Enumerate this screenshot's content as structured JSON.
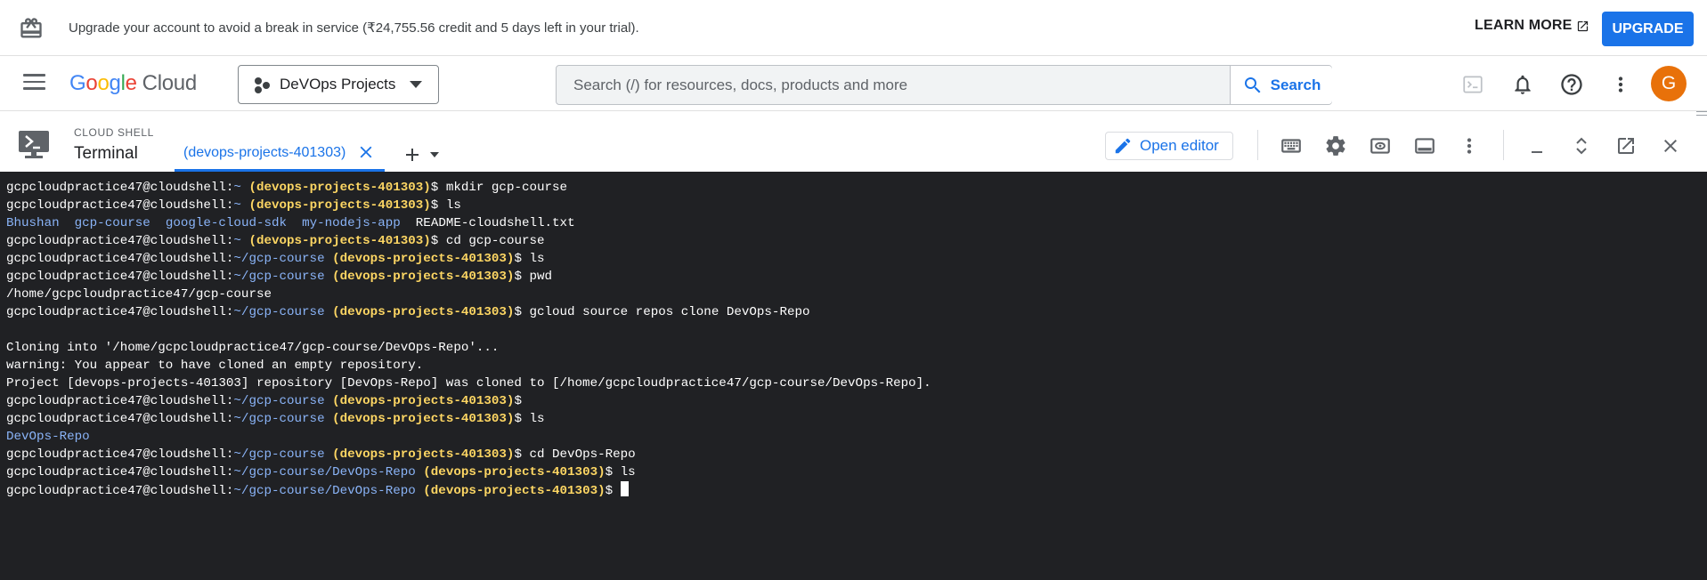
{
  "banner": {
    "message": "Upgrade your account to avoid a break in service (₹24,755.56 credit and 5 days left in your trial).",
    "learn_more": "LEARN MORE",
    "upgrade": "UPGRADE"
  },
  "topnav": {
    "logo_google": [
      "G",
      "o",
      "o",
      "g",
      "l",
      "e"
    ],
    "logo_cloud": "Cloud",
    "project_name": "DeVOps Projects",
    "search_placeholder": "Search (/) for resources, docs, products and more",
    "search_button": "Search",
    "avatar_letter": "G"
  },
  "shell": {
    "title": "CLOUD SHELL",
    "subtitle": "Terminal",
    "tab_label": "(devops-projects-401303)",
    "open_editor": "Open editor"
  },
  "terminal": {
    "user": "gcpcloudpractice47@cloudshell:",
    "project": "(devops-projects-401303)",
    "lines": [
      {
        "type": "prompt",
        "path": "~",
        "cmd": "mkdir gcp-course"
      },
      {
        "type": "prompt",
        "path": "~",
        "cmd": "ls"
      },
      {
        "type": "ls",
        "items": [
          {
            "t": "Bhushan",
            "dir": true
          },
          {
            "t": "gcp-course",
            "dir": true
          },
          {
            "t": "google-cloud-sdk",
            "dir": true
          },
          {
            "t": "my-nodejs-app",
            "dir": true
          },
          {
            "t": "README-cloudshell.txt",
            "dir": false
          }
        ]
      },
      {
        "type": "prompt",
        "path": "~",
        "cmd": "cd gcp-course"
      },
      {
        "type": "prompt",
        "path": "~/gcp-course",
        "cmd": "ls"
      },
      {
        "type": "prompt",
        "path": "~/gcp-course",
        "cmd": "pwd"
      },
      {
        "type": "out",
        "text": "/home/gcpcloudpractice47/gcp-course"
      },
      {
        "type": "prompt",
        "path": "~/gcp-course",
        "cmd": "gcloud source repos clone DevOps-Repo"
      },
      {
        "type": "out",
        "text": ""
      },
      {
        "type": "out",
        "text": "Cloning into '/home/gcpcloudpractice47/gcp-course/DevOps-Repo'..."
      },
      {
        "type": "out",
        "text": "warning: You appear to have cloned an empty repository."
      },
      {
        "type": "out",
        "text": "Project [devops-projects-401303] repository [DevOps-Repo] was cloned to [/home/gcpcloudpractice47/gcp-course/DevOps-Repo]."
      },
      {
        "type": "prompt",
        "path": "~/gcp-course",
        "cmd": ""
      },
      {
        "type": "prompt",
        "path": "~/gcp-course",
        "cmd": "ls"
      },
      {
        "type": "ls",
        "items": [
          {
            "t": "DevOps-Repo",
            "dir": true
          }
        ]
      },
      {
        "type": "prompt",
        "path": "~/gcp-course",
        "cmd": "cd DevOps-Repo"
      },
      {
        "type": "prompt",
        "path": "~/gcp-course/DevOps-Repo",
        "cmd": "ls"
      },
      {
        "type": "prompt",
        "path": "~/gcp-course/DevOps-Repo",
        "cmd": "",
        "cursor": true
      }
    ]
  },
  "colors": {
    "accent": "#1a73e8",
    "terminal_bg": "#202124",
    "prompt_path": "#8ab4f8",
    "prompt_project": "#fdd663",
    "avatar": "#e8710a"
  },
  "icons": [
    "gift-icon",
    "menu-icon",
    "project-icon",
    "search-icon",
    "cloud-shell-icon",
    "notifications-icon",
    "help-icon",
    "more-vert-icon",
    "terminal-icon",
    "close-icon",
    "add-icon",
    "chevron-down-icon",
    "edit-icon",
    "keyboard-icon",
    "settings-icon",
    "web-preview-icon",
    "layout-icon",
    "minimize-icon",
    "expand-icon",
    "open-new-window-icon"
  ]
}
